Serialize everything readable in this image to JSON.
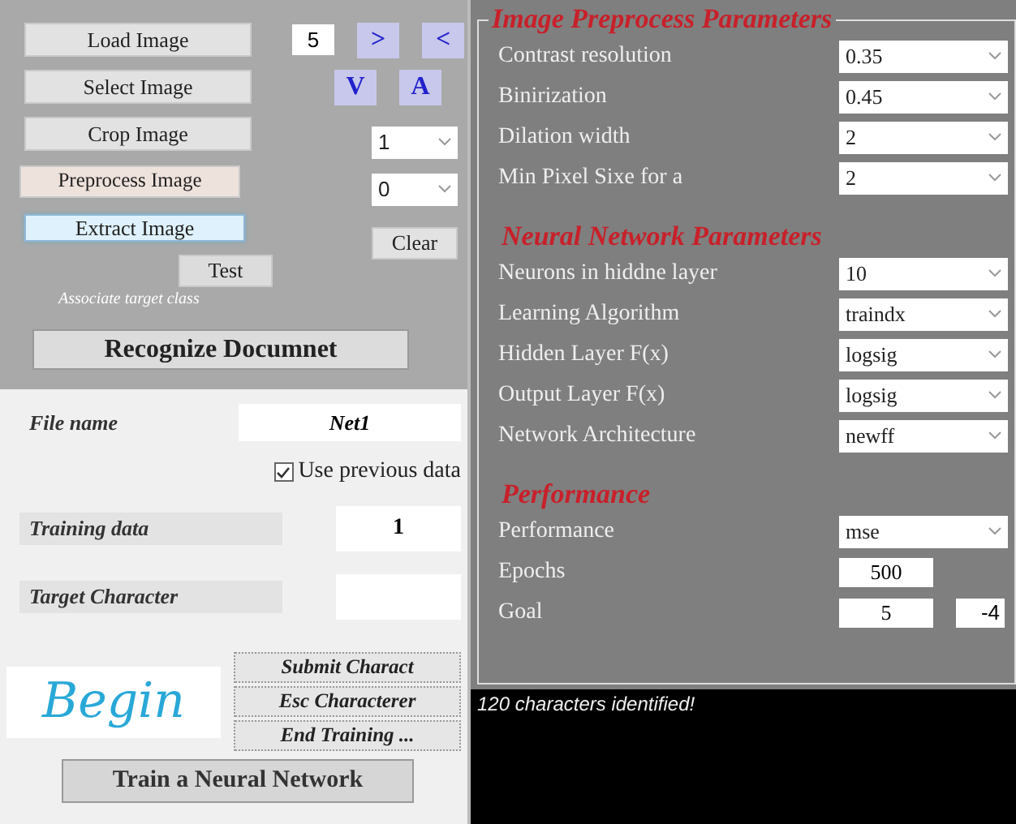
{
  "image_panel": {
    "load_button": "Load Image",
    "count_field": "5",
    "next_button": ">",
    "prev_button": "<",
    "select_button": "Select Image",
    "down_button": "V",
    "up_button": "A",
    "crop_button": "Crop Image",
    "crop_select": "1",
    "preprocess_button": "Preprocess Image",
    "preprocess_select": "0",
    "extract_button": "Extract Image",
    "clear_button": "Clear",
    "test_button": "Test",
    "hint": "Associate target class",
    "recognize_button": "Recognize Documnet"
  },
  "training_panel": {
    "file_name_label": "File name",
    "file_name": "Net1",
    "use_previous": {
      "label": "Use previous data",
      "checked": true
    },
    "training_data_label": "Training data",
    "training_data": "1",
    "target_label": "Target Character",
    "begin_text": "Begin",
    "actions": [
      "Submit Charact",
      "Esc Characterer",
      "End Training ..."
    ],
    "train_button": "Train a Neural Network"
  },
  "sections": [
    {
      "title": "Image Preprocess Parameters",
      "rows": [
        {
          "label": "Contrast resolution",
          "value": "0.35",
          "kind": "select"
        },
        {
          "label": "Binirization",
          "value": "0.45",
          "kind": "select"
        },
        {
          "label": "Dilation width",
          "value": "2",
          "kind": "select"
        },
        {
          "label": "Min Pixel Sixe for a",
          "value": "2",
          "kind": "select"
        }
      ]
    },
    {
      "title": "Neural Network Parameters",
      "rows": [
        {
          "label": "Neurons in hiddne layer",
          "value": "10",
          "kind": "select"
        },
        {
          "label": "Learning Algorithm",
          "value": "traindx",
          "kind": "select"
        },
        {
          "label": "Hidden Layer F(x)",
          "value": "logsig",
          "kind": "select"
        },
        {
          "label": "Output Layer F(x)",
          "value": "logsig",
          "kind": "select"
        },
        {
          "label": "Network Architecture",
          "value": "newff",
          "kind": "select"
        }
      ]
    },
    {
      "title": "Performance",
      "rows": [
        {
          "label": "Performance",
          "value": "mse",
          "kind": "select"
        },
        {
          "label": "Epochs",
          "value": "500",
          "kind": "field"
        },
        {
          "label": "Goal",
          "value": "5",
          "exponent": "-4",
          "kind": "field"
        }
      ]
    }
  ],
  "output": "120 characters identified!"
}
